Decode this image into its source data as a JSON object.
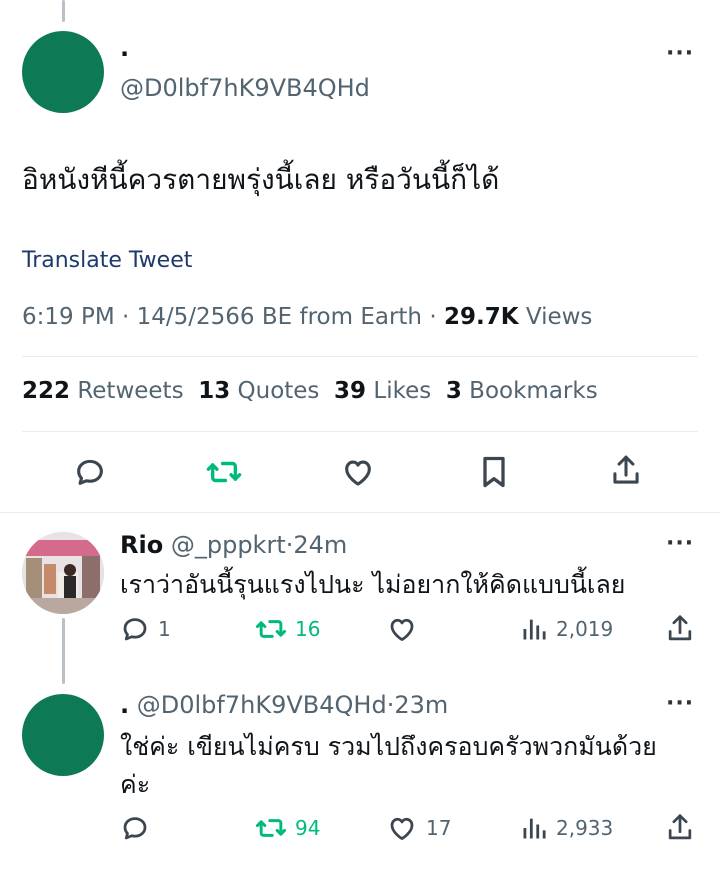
{
  "main_tweet": {
    "display_name": ".",
    "handle": "@D0lbf7hK9VB4QHd",
    "text": "อิหนังหีนี้ควรตายพรุ่งนี้เลย หรือวันนี้ก็ได้",
    "translate_label": "Translate Tweet",
    "meta": {
      "time": "6:19 PM",
      "date": "14/5/2566 BE from Earth",
      "views_count": "29.7K",
      "views_label": "Views",
      "separator": "·"
    },
    "stats": {
      "retweets": "222",
      "retweets_label": "Retweets",
      "quotes": "13",
      "quotes_label": "Quotes",
      "likes": "39",
      "likes_label": "Likes",
      "bookmarks": "3",
      "bookmarks_label": "Bookmarks"
    },
    "more_label": "···"
  },
  "replies": [
    {
      "display_name": "Rio",
      "handle": "@_pppkrt",
      "sep": "·",
      "time": "24m",
      "text": "เราว่าอันนี้รุนแรงไปนะ ไม่อยากให้คิดแบบนี้เลย",
      "reply_count": "1",
      "retweet_count": "16",
      "like_count": "",
      "views_count": "2,019",
      "more_label": "···"
    },
    {
      "display_name": ".",
      "handle": "@D0lbf7hK9VB4QHd",
      "sep": "·",
      "time": "23m",
      "text_line1": "ใช่ค่ะ เขียนไม่ครบ รวมไปถึงครอบครัวพวกมันด้วย",
      "text_line2": "ค่ะ",
      "reply_count": "",
      "retweet_count": "94",
      "like_count": "17",
      "views_count": "2,933",
      "more_label": "···"
    }
  ],
  "colors": {
    "avatar_green": "#0d7a55",
    "retweet_green": "#00ba7c",
    "link_blue": "#1d3a6b",
    "muted": "#536471"
  }
}
